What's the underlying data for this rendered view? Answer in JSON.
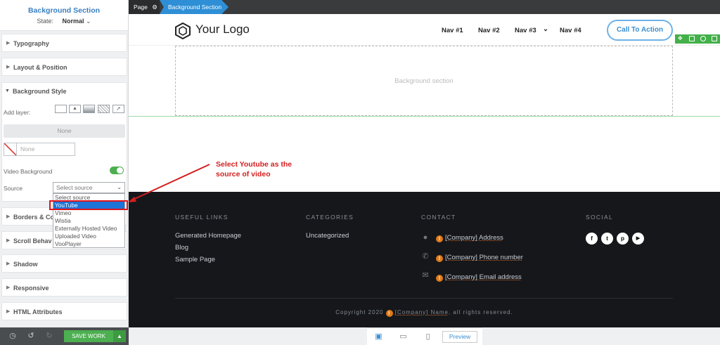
{
  "panel": {
    "title": "Background Section",
    "state_label": "State:",
    "state_value": "Normal",
    "sections": {
      "typography": "Typography",
      "layout": "Layout & Position",
      "bg_style": "Background Style",
      "borders": "Borders & Co",
      "scroll": "Scroll Behav",
      "shadow": "Shadow",
      "responsive": "Responsive",
      "html_attrs": "HTML Attributes"
    },
    "add_layer_label": "Add layer:",
    "layer_none": "None",
    "color_none": "None",
    "video_bg_label": "Video Background",
    "source_label": "Source",
    "source_placeholder": "Select source",
    "source_options": [
      "Select source",
      "YouTube",
      "Vimeo",
      "Wistia",
      "Externally Hosted Video",
      "Uploaded Video",
      "VooPlayer"
    ],
    "selected_option": "YouTube",
    "save_label": "SAVE WORK",
    "colors": {
      "accent": "#3a7fc1",
      "save": "#4caf50",
      "selection": "#1e73d6"
    }
  },
  "breadcrumb": {
    "page": "Page",
    "section": "Background Section"
  },
  "site": {
    "logo_text": "Your Logo",
    "nav": [
      "Nav #1",
      "Nav #2",
      "Nav #3",
      "Nav #4"
    ],
    "cta": "Call To Action",
    "bg_section_label": "Background section"
  },
  "footer": {
    "useful_links_title": "USEFUL LINKS",
    "useful_links": [
      "Generated Homepage",
      "Blog",
      "Sample Page"
    ],
    "categories_title": "CATEGORIES",
    "categories": [
      "Uncategorized"
    ],
    "contact_title": "CONTACT",
    "contact": [
      "[Company] Address",
      "[Company] Phone number",
      "[Company] Email address"
    ],
    "social_title": "SOCIAL",
    "copyright_prefix": "Copyright 2020",
    "copyright_company": "[Company] Name",
    "copyright_suffix": ", all rights reserved."
  },
  "device_bar": {
    "preview": "Preview"
  },
  "annotation": {
    "line1": "Select Youtube as the",
    "line2": "source of video",
    "color": "#d31f1f"
  }
}
